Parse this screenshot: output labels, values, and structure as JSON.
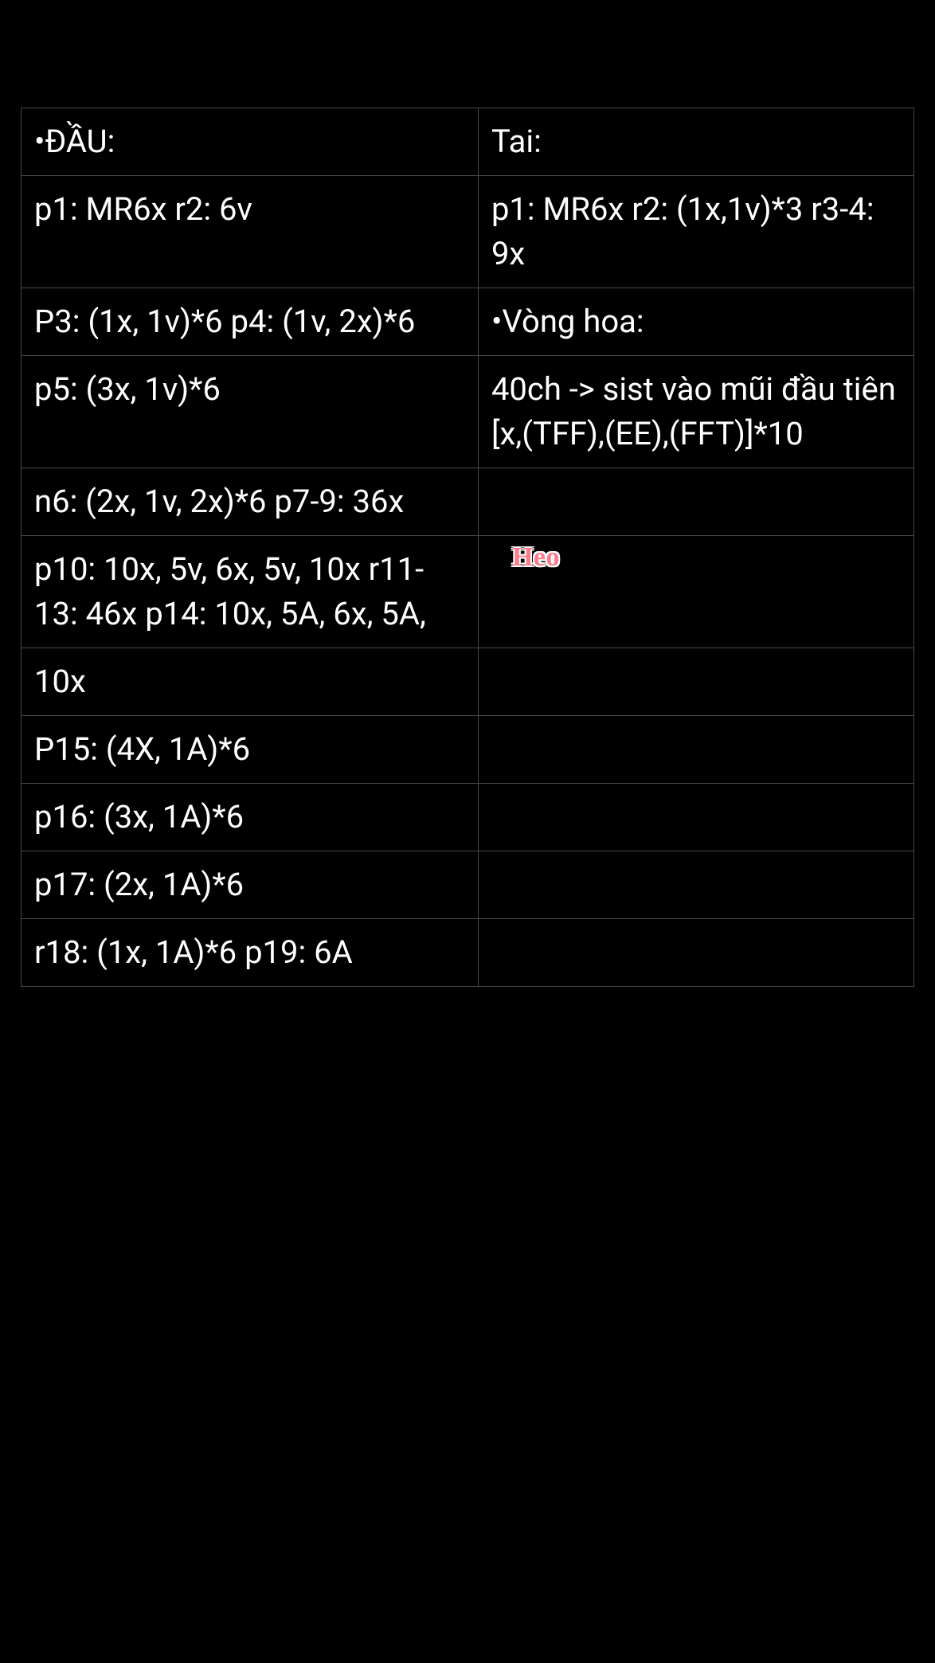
{
  "table": {
    "rows": [
      {
        "left": "•ĐẦU:",
        "right": "Tai:"
      },
      {
        "left": "p1: MR6x r2: 6v",
        "right": "p1: MR6x r2: (1x,1v)*3 r3-4: 9x"
      },
      {
        "left": "P3: (1x, 1v)*6 p4: (1v, 2x)*6",
        "right": "•Vòng hoa:"
      },
      {
        "left": "p5: (3x, 1v)*6",
        "right": "40ch -> sist vào mũi đầu tiên [x,(TFF),(EE),(FFT)]*10"
      },
      {
        "left": "n6: (2x, 1v, 2x)*6 p7-9: 36x",
        "right": ""
      },
      {
        "left": "p10: 10x, 5v, 6x, 5v, 10x r11-13: 46x p14: 10x, 5A, 6x, 5A,",
        "right": ""
      },
      {
        "left": "10x",
        "right": ""
      },
      {
        "left": "P15: (4X, 1A)*6",
        "right": ""
      },
      {
        "left": "p16: (3x, 1A)*6",
        "right": ""
      },
      {
        "left": "p17: (2x, 1A)*6",
        "right": ""
      },
      {
        "left": "r18: (1x, 1A)*6 p19: 6A",
        "right": ""
      }
    ]
  },
  "sticker": {
    "text": "Heo"
  }
}
